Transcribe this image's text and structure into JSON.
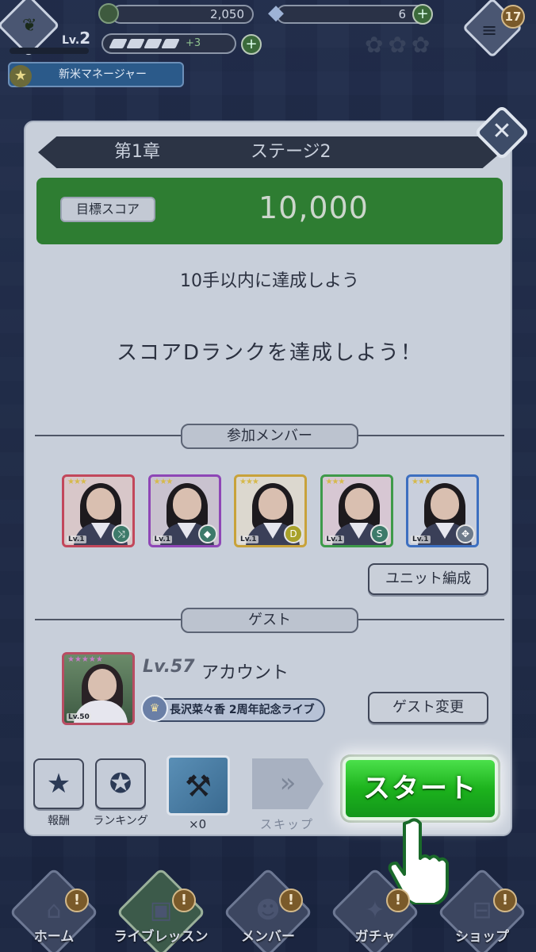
{
  "hud": {
    "level_prefix": "Lv.",
    "level": "2",
    "coins": "2,050",
    "gems": "6",
    "stamina_extra": "+3",
    "notifications": "17",
    "title": "新米マネージャー"
  },
  "dialog": {
    "chapter": "第1章",
    "stage": "ステージ2",
    "target_label": "目標スコア",
    "target_value": "10,000",
    "mission_1": "10手以内に達成しよう",
    "mission_2": "スコアDランクを達成しよう！",
    "members_header": "参加メンバー",
    "members": [
      {
        "stars": "★★★",
        "lv": "Lv.1",
        "frame": "#c2475b",
        "skill_color": "#3d7a6a",
        "skill": "⤨"
      },
      {
        "stars": "★★★",
        "lv": "Lv.1",
        "frame": "#8e46b6",
        "skill_color": "#3d7a6a",
        "skill": "◆"
      },
      {
        "stars": "★★★",
        "lv": "Lv.1",
        "frame": "#c8a23a",
        "skill_color": "#a8a12a",
        "skill": "D"
      },
      {
        "stars": "★★★",
        "lv": "Lv.1",
        "frame": "#3e9a4a",
        "skill_color": "#3d7a6a",
        "skill": "S"
      },
      {
        "stars": "★★★",
        "lv": "Lv.1",
        "frame": "#3d6fc0",
        "skill_color": "#6d7a8a",
        "skill": "✥"
      }
    ],
    "unit_button": "ユニット編成",
    "guest_header": "ゲスト",
    "guest": {
      "level_prefix": "Lv.",
      "level": "57",
      "name": "アカウント",
      "card_stars": "★★★★★",
      "card_lv": "Lv.50",
      "title": "長沢菜々香 2周年記念ライブ"
    },
    "guest_change_button": "ゲスト変更",
    "reward_label": "報酬",
    "ranking_label": "ランキング",
    "item_count": "×0",
    "skip_label": "スキップ",
    "start_button": "スタート"
  },
  "nav": [
    {
      "label": "ホーム",
      "alert": "!"
    },
    {
      "label": "ライブレッスン",
      "alert": "!"
    },
    {
      "label": "メンバー",
      "alert": "!"
    },
    {
      "label": "ガチャ",
      "alert": "!"
    },
    {
      "label": "ショップ",
      "alert": "!"
    }
  ]
}
